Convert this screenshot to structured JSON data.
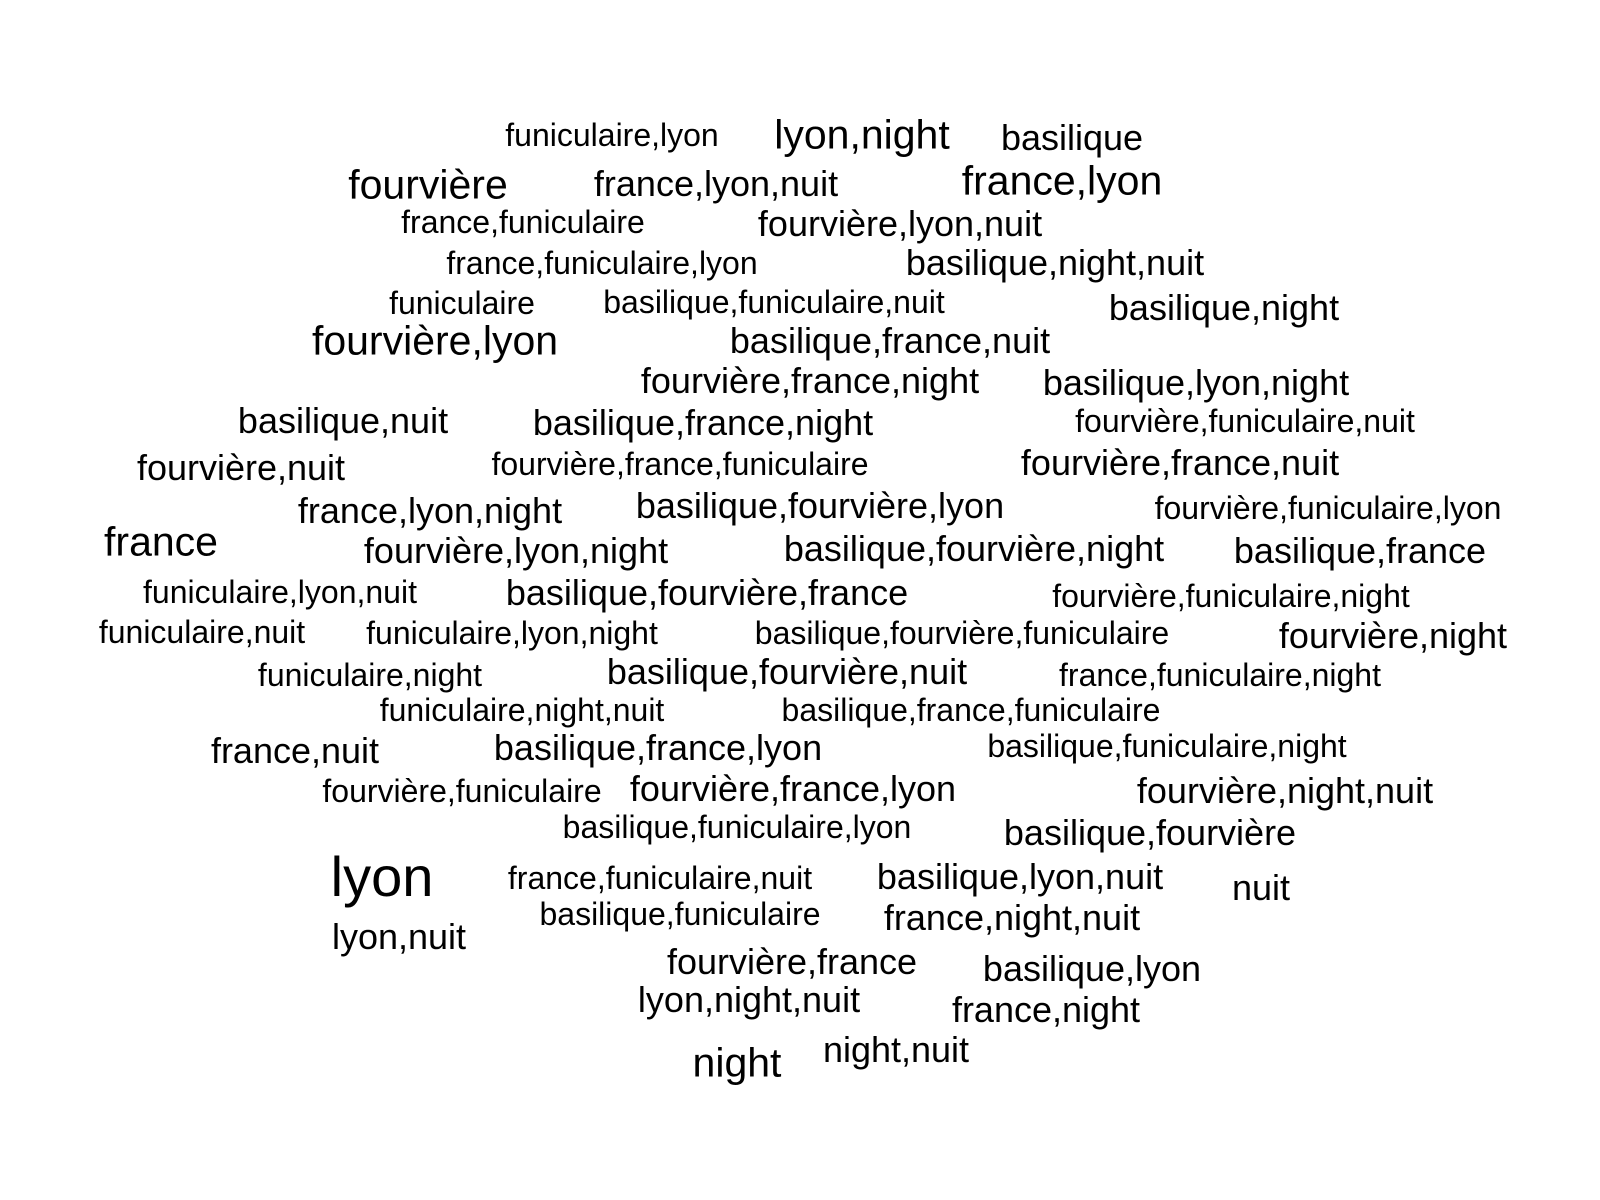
{
  "words": [
    {
      "text": "funiculaire,lyon",
      "weight": 1
    },
    {
      "text": "lyon,night",
      "weight": 3
    },
    {
      "text": "basilique",
      "weight": 2
    },
    {
      "text": "fourvière",
      "weight": 3
    },
    {
      "text": "france,lyon,nuit",
      "weight": 2
    },
    {
      "text": "france,lyon",
      "weight": 3
    },
    {
      "text": "france,funiculaire",
      "weight": 1
    },
    {
      "text": "fourvière,lyon,nuit",
      "weight": 2
    },
    {
      "text": "france,funiculaire,lyon",
      "weight": 1
    },
    {
      "text": "basilique,night,nuit",
      "weight": 2
    },
    {
      "text": "funiculaire",
      "weight": 1
    },
    {
      "text": "basilique,funiculaire,nuit",
      "weight": 1
    },
    {
      "text": "basilique,night",
      "weight": 2
    },
    {
      "text": "fourvière,lyon",
      "weight": 3
    },
    {
      "text": "basilique,france,nuit",
      "weight": 2
    },
    {
      "text": "fourvière,france,night",
      "weight": 2
    },
    {
      "text": "basilique,lyon,night",
      "weight": 2
    },
    {
      "text": "basilique,nuit",
      "weight": 2
    },
    {
      "text": "basilique,france,night",
      "weight": 2
    },
    {
      "text": "fourvière,funiculaire,nuit",
      "weight": 1
    },
    {
      "text": "fourvière,nuit",
      "weight": 2
    },
    {
      "text": "fourvière,france,funiculaire",
      "weight": 1
    },
    {
      "text": "fourvière,france,nuit",
      "weight": 2
    },
    {
      "text": "france,lyon,night",
      "weight": 2
    },
    {
      "text": "basilique,fourvière,lyon",
      "weight": 2
    },
    {
      "text": "fourvière,funiculaire,lyon",
      "weight": 1
    },
    {
      "text": "france",
      "weight": 3
    },
    {
      "text": "fourvière,lyon,night",
      "weight": 2
    },
    {
      "text": "basilique,fourvière,night",
      "weight": 2
    },
    {
      "text": "basilique,france",
      "weight": 2
    },
    {
      "text": "funiculaire,lyon,nuit",
      "weight": 1
    },
    {
      "text": "basilique,fourvière,france",
      "weight": 2
    },
    {
      "text": "fourvière,funiculaire,night",
      "weight": 1
    },
    {
      "text": "funiculaire,nuit",
      "weight": 1
    },
    {
      "text": "funiculaire,lyon,night",
      "weight": 1
    },
    {
      "text": "basilique,fourvière,funiculaire",
      "weight": 1
    },
    {
      "text": "fourvière,night",
      "weight": 2
    },
    {
      "text": "funiculaire,night",
      "weight": 1
    },
    {
      "text": "basilique,fourvière,nuit",
      "weight": 2
    },
    {
      "text": "france,funiculaire,night",
      "weight": 1
    },
    {
      "text": "funiculaire,night,nuit",
      "weight": 1
    },
    {
      "text": "basilique,france,funiculaire",
      "weight": 1
    },
    {
      "text": "france,nuit",
      "weight": 2
    },
    {
      "text": "basilique,france,lyon",
      "weight": 2
    },
    {
      "text": "basilique,funiculaire,night",
      "weight": 1
    },
    {
      "text": "fourvière,funiculaire",
      "weight": 1
    },
    {
      "text": "fourvière,france,lyon",
      "weight": 2
    },
    {
      "text": "fourvière,night,nuit",
      "weight": 2
    },
    {
      "text": "basilique,funiculaire,lyon",
      "weight": 1
    },
    {
      "text": "basilique,fourvière",
      "weight": 2
    },
    {
      "text": "lyon",
      "weight": 5
    },
    {
      "text": "france,funiculaire,nuit",
      "weight": 1
    },
    {
      "text": "basilique,lyon,nuit",
      "weight": 2
    },
    {
      "text": "nuit",
      "weight": 2
    },
    {
      "text": "basilique,funiculaire",
      "weight": 1
    },
    {
      "text": "france,night,nuit",
      "weight": 2
    },
    {
      "text": "lyon,nuit",
      "weight": 2
    },
    {
      "text": "fourvière,france",
      "weight": 2
    },
    {
      "text": "basilique,lyon",
      "weight": 2
    },
    {
      "text": "lyon,night,nuit",
      "weight": 2
    },
    {
      "text": "france,night",
      "weight": 2
    },
    {
      "text": "night",
      "weight": 3
    },
    {
      "text": "night,nuit",
      "weight": 2
    }
  ]
}
